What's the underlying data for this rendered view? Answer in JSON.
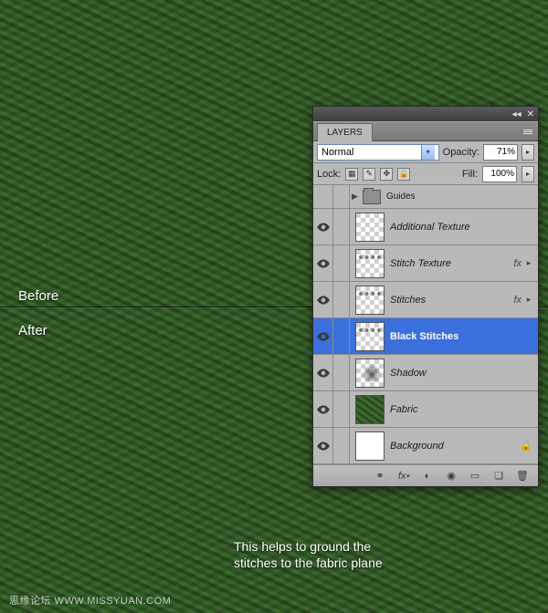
{
  "labels": {
    "before": "Before",
    "after": "After"
  },
  "caption": "This helps to ground the stitches to the fabric plane",
  "watermark": "思缘论坛  WWW.MISSYUAN.COM",
  "panel": {
    "tab": "LAYERS",
    "blend_mode": "Normal",
    "opacity_label": "Opacity:",
    "opacity_value": "71%",
    "lock_label": "Lock:",
    "fill_label": "Fill:",
    "fill_value": "100%",
    "group": {
      "name": "Guides"
    },
    "layers": [
      {
        "name": "Additional Texture",
        "fx": false,
        "thumb": "transparent",
        "italic": true
      },
      {
        "name": "Stitch Texture",
        "fx": true,
        "thumb": "stitch",
        "italic": true
      },
      {
        "name": "Stitches",
        "fx": true,
        "thumb": "stitch",
        "italic": true
      },
      {
        "name": "Black Stitches",
        "fx": false,
        "thumb": "stitch",
        "selected": true
      },
      {
        "name": "Shadow",
        "fx": false,
        "thumb": "shadow",
        "italic": true
      },
      {
        "name": "Fabric",
        "fx": false,
        "thumb": "fabric",
        "italic": true
      },
      {
        "name": "Background",
        "fx": false,
        "thumb": "white",
        "italic": true,
        "locked": true
      }
    ],
    "footer_icons": [
      "link",
      "fx",
      "mask",
      "adjust",
      "group",
      "new",
      "trash"
    ]
  }
}
